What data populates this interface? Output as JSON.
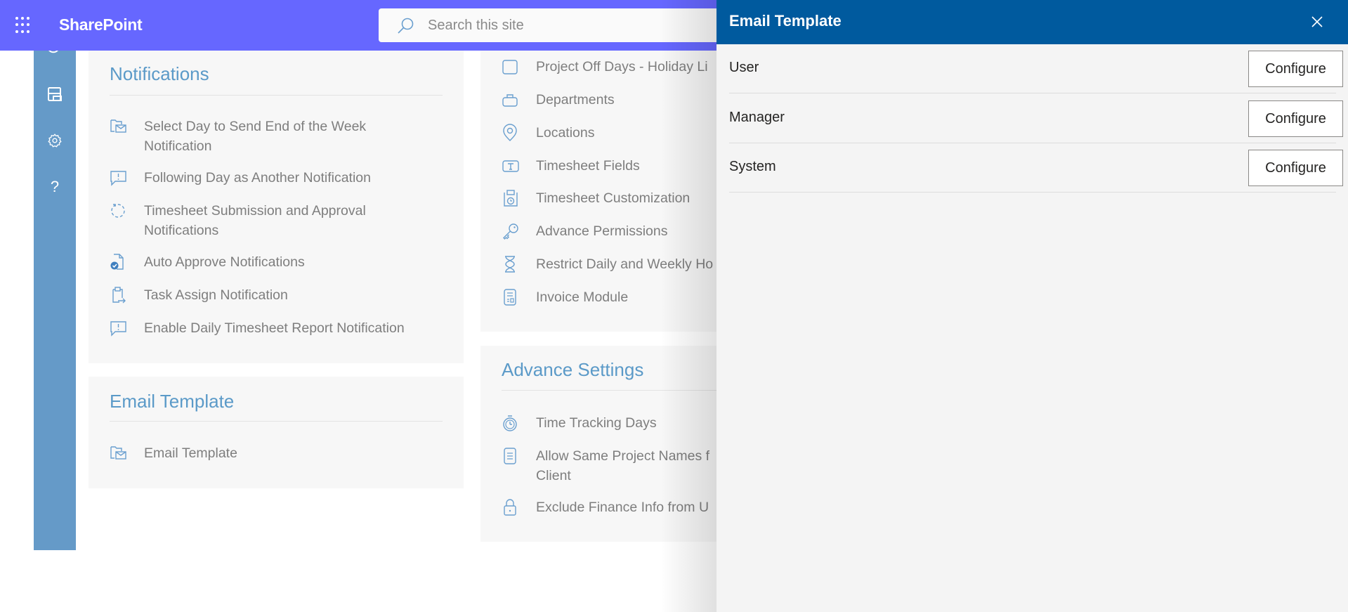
{
  "topbar": {
    "app_name": "SharePoint",
    "search_placeholder": "Search this site",
    "icons": {
      "app_launcher": "waffle-icon",
      "search": "search-icon"
    }
  },
  "sidebar": {
    "icons": [
      "settings-badge-icon",
      "layout-icon",
      "gear-icon",
      "help-icon"
    ]
  },
  "left_column": {
    "notifications": {
      "title": "Notifications",
      "items": [
        {
          "label_line1": "Select Day to Send End of the Week",
          "label_line2": "Notification",
          "icon": "folder-mail-icon"
        },
        {
          "label_line1": "Following Day as Another Notification",
          "icon": "comment-alert-icon"
        },
        {
          "label_line1": "Timesheet Submission and Approval",
          "label_line2": "Notifications",
          "icon": "sync-circle-icon"
        },
        {
          "label_line1": "Auto Approve Notifications",
          "icon": "document-approve-icon"
        },
        {
          "label_line1": "Task Assign Notification",
          "icon": "clipboard-assign-icon"
        },
        {
          "label_line1": "Enable Daily Timesheet Report Notification",
          "icon": "comment-alert-icon"
        }
      ]
    },
    "email_template": {
      "title": "Email Template",
      "items": [
        {
          "label_line1": "Email Template",
          "icon": "folder-mail-icon"
        }
      ]
    }
  },
  "right_column": {
    "general": {
      "items": [
        {
          "label_line1": "Project Off Days - Holiday Li",
          "icon": "checkbox-icon"
        },
        {
          "label_line1": "Departments",
          "icon": "briefcase-icon"
        },
        {
          "label_line1": "Locations",
          "icon": "location-pin-icon"
        },
        {
          "label_line1": "Timesheet Fields",
          "icon": "text-field-icon"
        },
        {
          "label_line1": "Timesheet Customization",
          "icon": "calendar-clock-icon"
        },
        {
          "label_line1": "Advance Permissions",
          "icon": "key-icon"
        },
        {
          "label_line1": "Restrict Daily and Weekly Ho",
          "icon": "hourglass-icon"
        },
        {
          "label_line1": "Invoice Module",
          "icon": "invoice-icon"
        }
      ]
    },
    "advance_settings": {
      "title": "Advance Settings",
      "items": [
        {
          "label_line1": "Time Tracking Days",
          "icon": "timer-icon"
        },
        {
          "label_line1": "Allow Same Project Names f",
          "label_line2": "Client",
          "icon": "document-list-icon"
        },
        {
          "label_line1": "Exclude Finance Info from U",
          "icon": "lock-icon"
        }
      ]
    }
  },
  "panel": {
    "title": "Email Template",
    "close_icon": "close-icon",
    "rows": [
      {
        "label": "User",
        "button": "Configure"
      },
      {
        "label": "Manager",
        "button": "Configure"
      },
      {
        "label": "System",
        "button": "Configure"
      }
    ]
  },
  "colors": {
    "topbar": "#6667ff",
    "panel_header": "#005a9e",
    "sidebar": "#659ac8",
    "accent_text": "#5b9ac8",
    "item_text": "#7e7e7e"
  }
}
